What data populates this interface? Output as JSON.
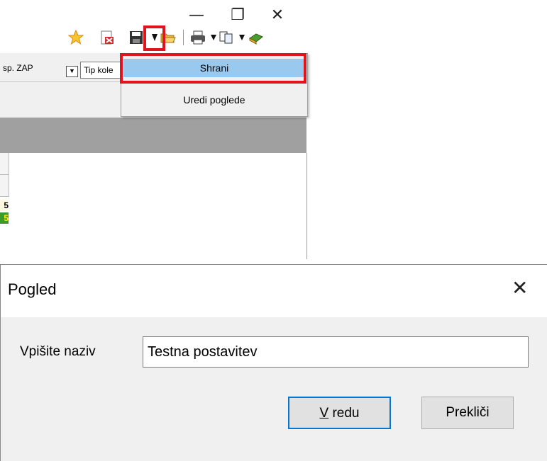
{
  "window_controls": {
    "minimize": "—",
    "restore": "❐",
    "close": "✕"
  },
  "toolbar": {
    "icons": [
      "star-icon",
      "pdf-icon",
      "save-icon",
      "arrow-down-icon",
      "folder-open-icon",
      "print-icon",
      "arrow-down-icon",
      "copy-icon",
      "arrow-down-icon",
      "book-icon"
    ]
  },
  "filterbar": {
    "resp_label": "sp. ZAP",
    "dropdown_glyph": "▼",
    "tip_label": "Tip kole"
  },
  "menu": {
    "items": [
      "Shrani",
      "Uredi poglede"
    ]
  },
  "grid": {
    "row_values": [
      "5",
      "5"
    ]
  },
  "colors": {
    "highlight": "#e0141e",
    "menu_selected": "#99c9ef",
    "default_button_border": "#0078d7"
  },
  "dialog": {
    "title": "Pogled",
    "close_glyph": "✕",
    "label": "Vpišite naziv",
    "input_value": "Testna postavitev",
    "ok_mnemonic": "V",
    "ok_rest": " redu",
    "cancel": "Prekliči"
  }
}
